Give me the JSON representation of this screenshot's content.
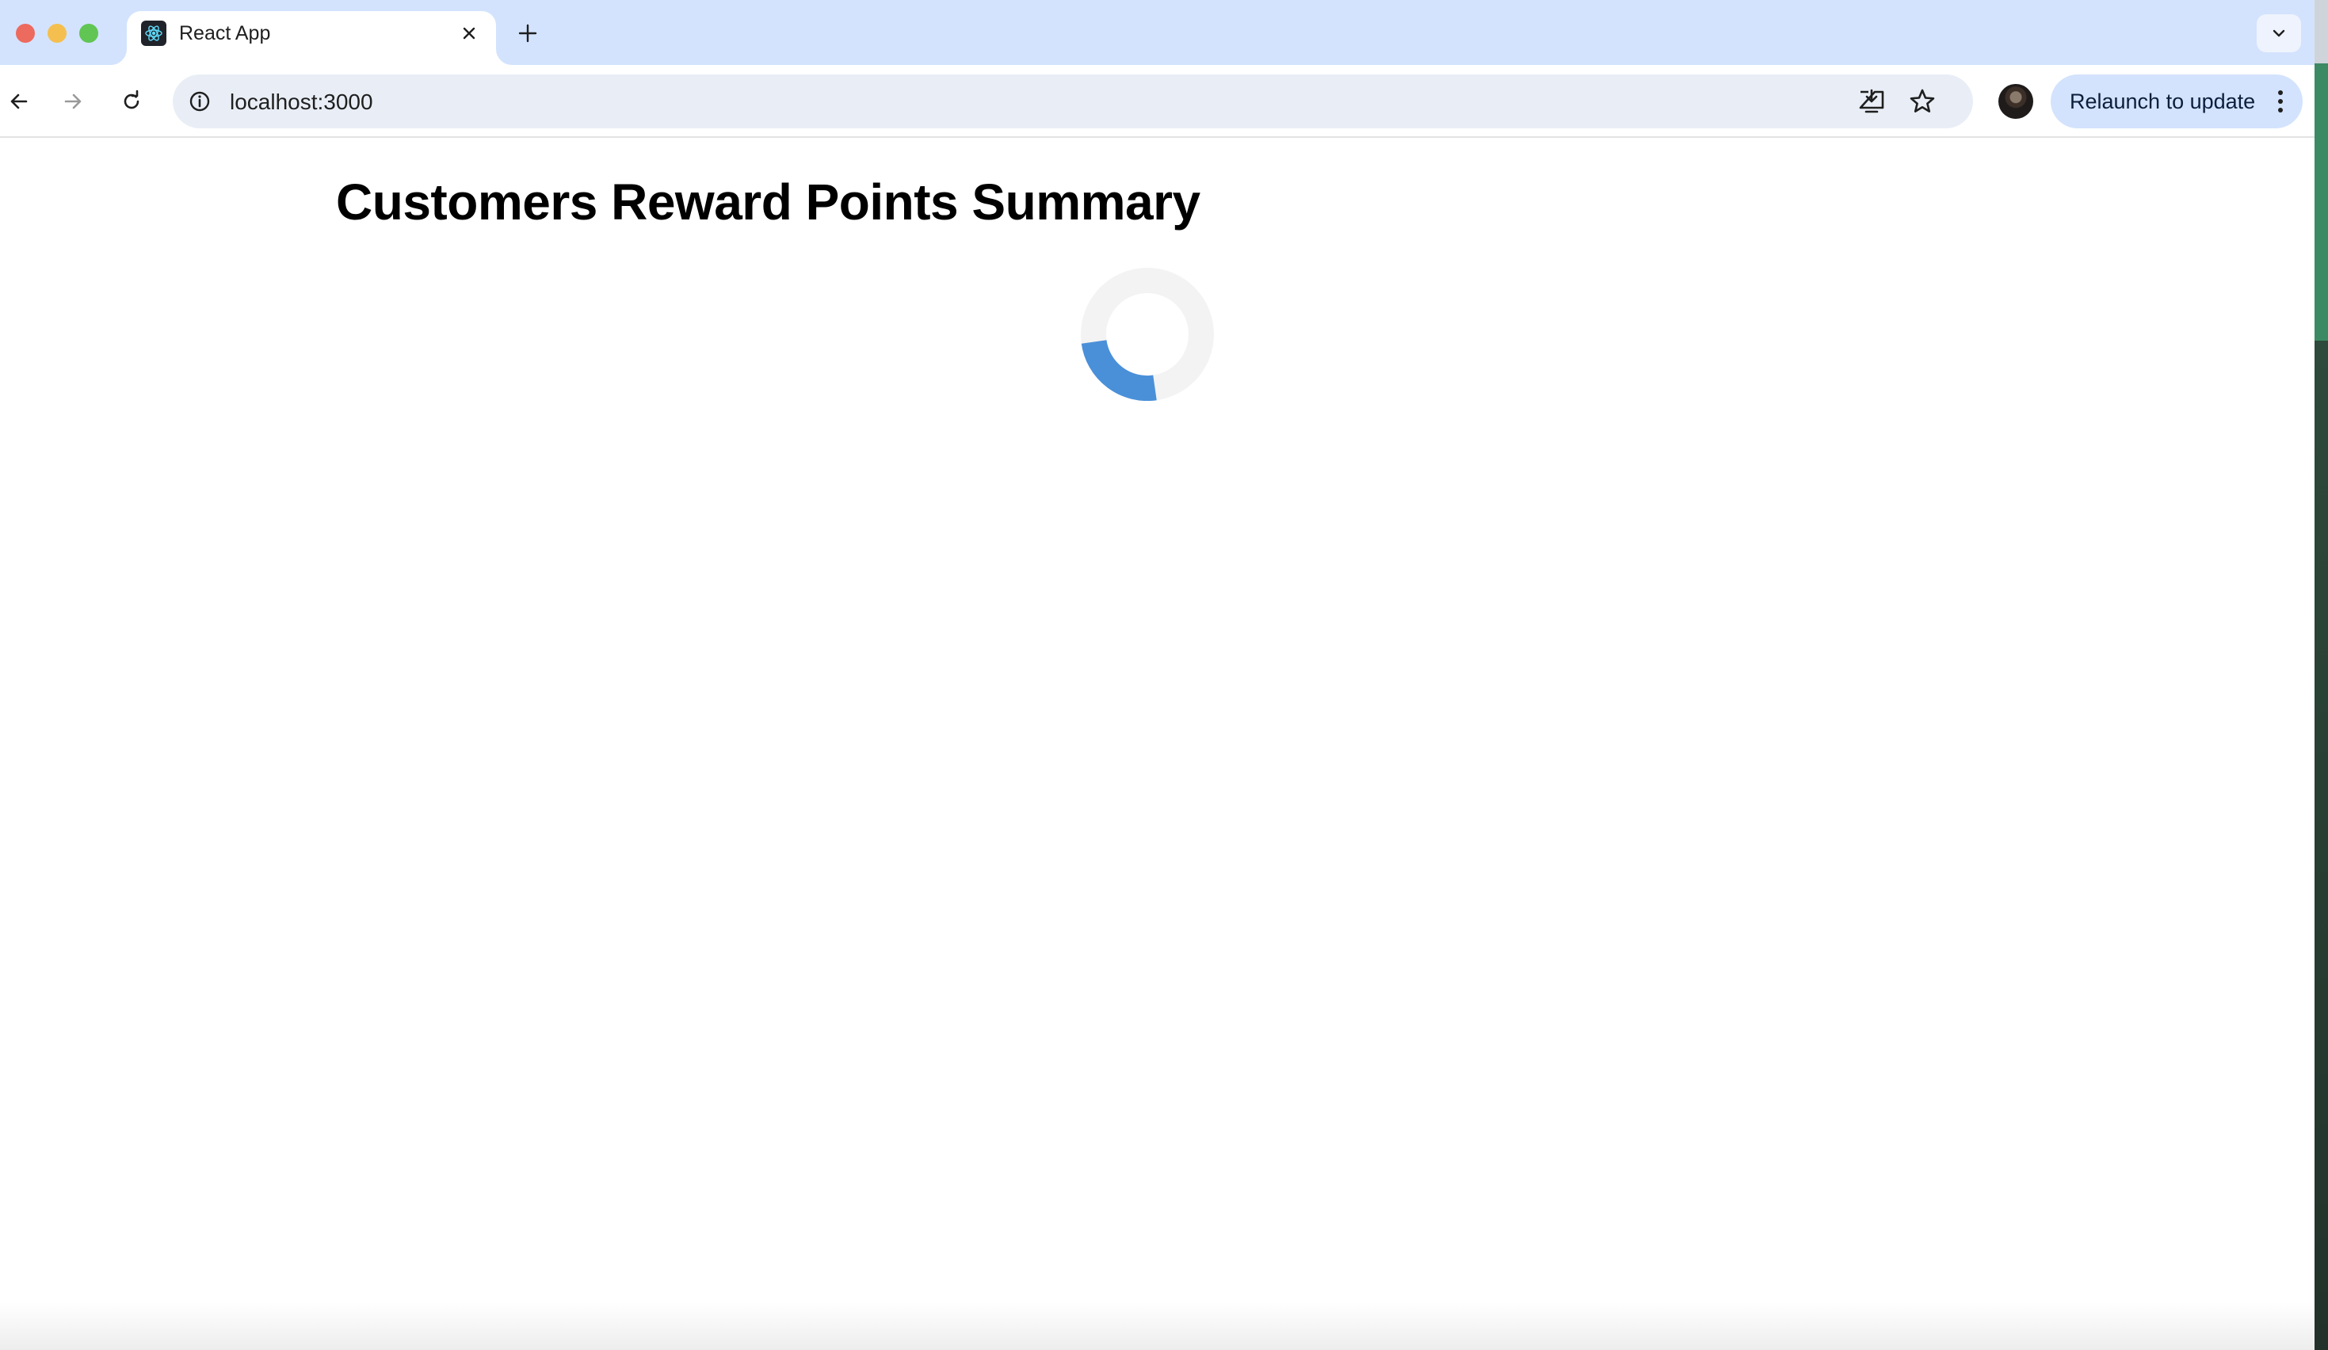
{
  "browser": {
    "tab": {
      "title": "React App",
      "favicon": "react-logo-icon"
    },
    "address_bar": {
      "url": "localhost:3000"
    },
    "relaunch_button": {
      "label": "Relaunch to update"
    },
    "accent_color": "#d3e3fd"
  },
  "page": {
    "title": "Customers Reward Points Summary",
    "loading_indicator": {
      "type": "spinner-icon",
      "color": "#4a90d9",
      "track_color": "#f3f3f3"
    }
  }
}
